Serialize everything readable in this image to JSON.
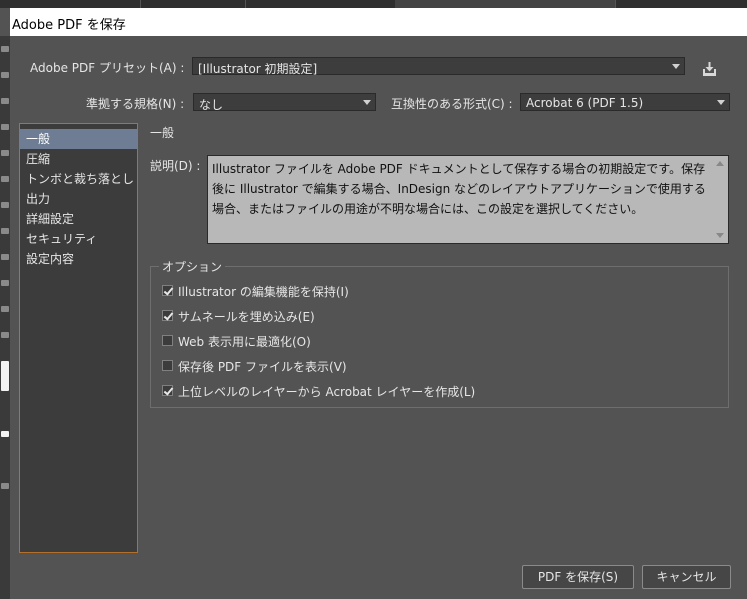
{
  "dialog": {
    "title": "Adobe PDF を保存"
  },
  "preset": {
    "label": "Adobe PDF プリセット(A) :",
    "value": "[Illustrator 初期設定]"
  },
  "standard": {
    "label": "準拠する規格(N) :",
    "value": "なし"
  },
  "compatibility": {
    "label": "互換性のある形式(C) :",
    "value": "Acrobat 6 (PDF 1.5)"
  },
  "sidebar": {
    "items": [
      {
        "label": "一般",
        "selected": true
      },
      {
        "label": "圧縮",
        "selected": false
      },
      {
        "label": "トンボと裁ち落とし",
        "selected": false
      },
      {
        "label": "出力",
        "selected": false
      },
      {
        "label": "詳細設定",
        "selected": false
      },
      {
        "label": "セキュリティ",
        "selected": false
      },
      {
        "label": "設定内容",
        "selected": false
      }
    ]
  },
  "main": {
    "section_title": "一般",
    "description_label": "説明(D) :",
    "description_text": "Illustrator ファイルを Adobe PDF ドキュメントとして保存する場合の初期設定です。保存後に Illustrator で編集する場合、InDesign などのレイアウトアプリケーションで使用する場合、またはファイルの用途が不明な場合には、この設定を選択してください。"
  },
  "options": {
    "title": "オプション",
    "items": [
      {
        "label": "Illustrator の編集機能を保持(I)",
        "checked": true
      },
      {
        "label": "サムネールを埋め込み(E)",
        "checked": true
      },
      {
        "label": "Web 表示用に最適化(O)",
        "checked": false
      },
      {
        "label": "保存後 PDF ファイルを表示(V)",
        "checked": false
      },
      {
        "label": "上位レベルのレイヤーから Acrobat レイヤーを作成(L)",
        "checked": true
      }
    ]
  },
  "buttons": {
    "save": "PDF を保存(S)",
    "cancel": "キャンセル"
  },
  "icons": {
    "preset_save": "save-preset-icon"
  },
  "colors": {
    "selection": "#6e7d93",
    "focus_border": "#b3702a"
  }
}
